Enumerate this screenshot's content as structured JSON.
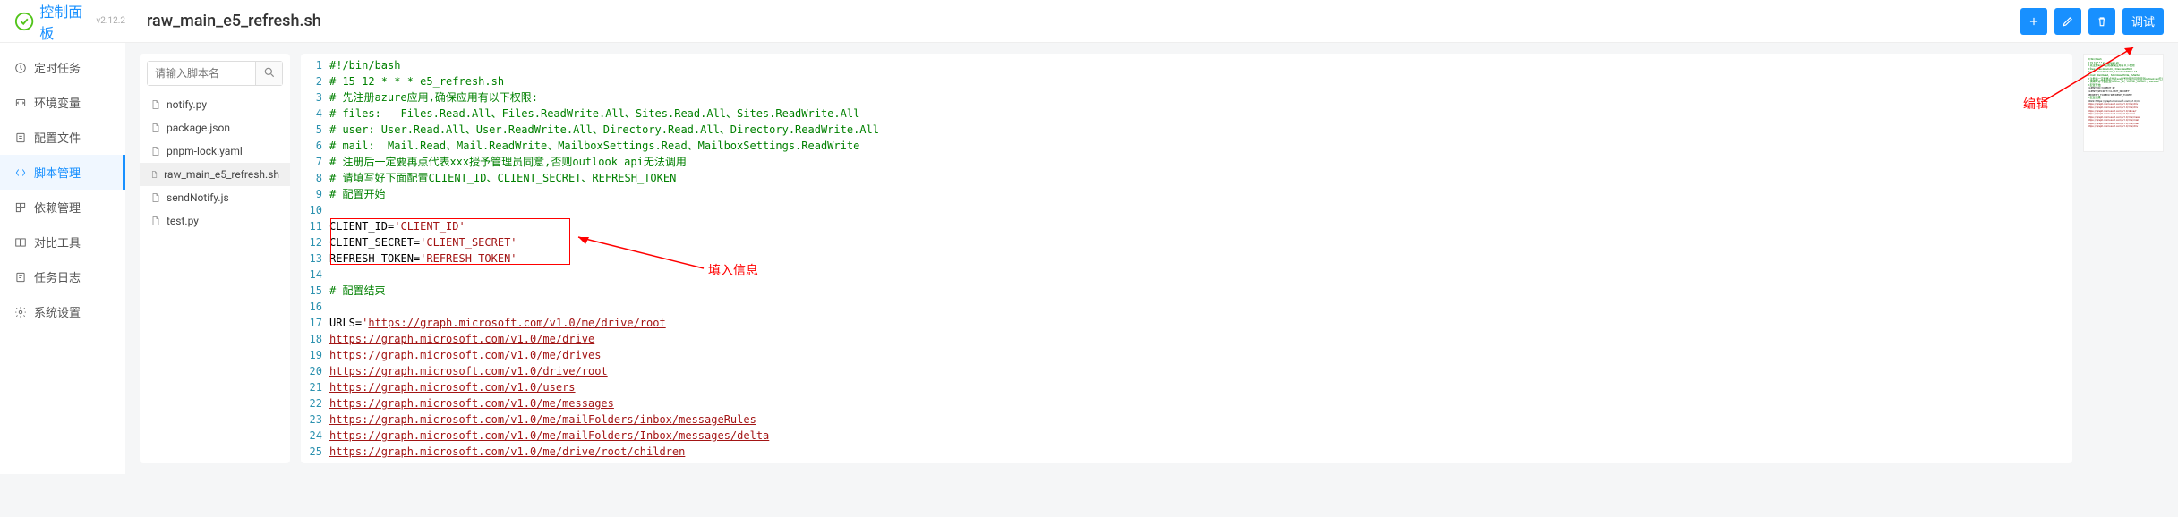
{
  "header": {
    "logo_title": "控制面板",
    "version": "v2.12.2",
    "page_title": "raw_main_e5_refresh.sh",
    "debug_btn": "调试"
  },
  "sidebar": {
    "items": [
      {
        "icon": "clock",
        "label": "定时任务"
      },
      {
        "icon": "env",
        "label": "环境变量"
      },
      {
        "icon": "config",
        "label": "配置文件"
      },
      {
        "icon": "script",
        "label": "脚本管理"
      },
      {
        "icon": "deps",
        "label": "依赖管理"
      },
      {
        "icon": "diff",
        "label": "对比工具"
      },
      {
        "icon": "log",
        "label": "任务日志"
      },
      {
        "icon": "settings",
        "label": "系统设置"
      }
    ],
    "active_index": 3
  },
  "file_panel": {
    "search_placeholder": "请输入脚本名",
    "files": [
      {
        "name": "notify.py"
      },
      {
        "name": "package.json"
      },
      {
        "name": "pnpm-lock.yaml"
      },
      {
        "name": "raw_main_e5_refresh.sh"
      },
      {
        "name": "sendNotify.js"
      },
      {
        "name": "test.py"
      }
    ],
    "active_index": 3
  },
  "editor": {
    "lines": [
      {
        "n": 1,
        "cls": "c-comment",
        "t": "#!/bin/bash"
      },
      {
        "n": 2,
        "cls": "c-comment",
        "t": "# 15 12 * * * e5_refresh.sh"
      },
      {
        "n": 3,
        "cls": "c-comment",
        "t": "# 先注册azure应用,确保应用有以下权限:"
      },
      {
        "n": 4,
        "cls": "c-comment",
        "t": "# files:   Files.Read.All、Files.ReadWrite.All、Sites.Read.All、Sites.ReadWrite.All"
      },
      {
        "n": 5,
        "cls": "c-comment",
        "t": "# user: User.Read.All、User.ReadWrite.All、Directory.Read.All、Directory.ReadWrite.All"
      },
      {
        "n": 6,
        "cls": "c-comment",
        "t": "# mail:  Mail.Read、Mail.ReadWrite、MailboxSettings.Read、MailboxSettings.ReadWrite"
      },
      {
        "n": 7,
        "cls": "c-comment",
        "t": "# 注册后一定要再点代表xxx授予管理员同意,否则outlook api无法调用"
      },
      {
        "n": 8,
        "cls": "c-comment",
        "t": "# 请填写好下面配置CLIENT_ID、CLIENT_SECRET、REFRESH_TOKEN"
      },
      {
        "n": 9,
        "cls": "c-comment",
        "t": "# 配置开始"
      },
      {
        "n": 10,
        "cls": "",
        "t": ""
      },
      {
        "n": 11,
        "cls": "",
        "html": "<span class='c-var'>CLIENT_ID=</span><span class='c-string'>'CLIENT_ID'</span>"
      },
      {
        "n": 12,
        "cls": "",
        "html": "<span class='c-var'>CLIENT_SECRET=</span><span class='c-string'>'CLIENT_SECRET'</span>"
      },
      {
        "n": 13,
        "cls": "",
        "html": "<span class='c-var'>REFRESH_TOKEN=</span><span class='c-string'>'REFRESH_TOKEN'</span>"
      },
      {
        "n": 14,
        "cls": "",
        "t": ""
      },
      {
        "n": 15,
        "cls": "c-comment",
        "t": "# 配置结束"
      },
      {
        "n": 16,
        "cls": "",
        "t": ""
      },
      {
        "n": 17,
        "cls": "",
        "html": "<span class='c-var'>URLS=</span><span class='c-string'>'</span><span class='c-url'>https://graph.microsoft.com/v1.0/me/drive/root</span>"
      },
      {
        "n": 18,
        "cls": "c-url",
        "t": "https://graph.microsoft.com/v1.0/me/drive"
      },
      {
        "n": 19,
        "cls": "c-url",
        "t": "https://graph.microsoft.com/v1.0/me/drives"
      },
      {
        "n": 20,
        "cls": "c-url",
        "t": "https://graph.microsoft.com/v1.0/drive/root"
      },
      {
        "n": 21,
        "cls": "c-url",
        "t": "https://graph.microsoft.com/v1.0/users"
      },
      {
        "n": 22,
        "cls": "c-url",
        "t": "https://graph.microsoft.com/v1.0/me/messages"
      },
      {
        "n": 23,
        "cls": "c-url",
        "t": "https://graph.microsoft.com/v1.0/me/mailFolders/inbox/messageRules"
      },
      {
        "n": 24,
        "cls": "c-url",
        "t": "https://graph.microsoft.com/v1.0/me/mailFolders/Inbox/messages/delta"
      },
      {
        "n": 25,
        "cls": "c-url",
        "t": "https://graph.microsoft.com/v1.0/me/drive/root/children"
      }
    ]
  },
  "annotations": {
    "fill_info": "填入信息",
    "edit": "编辑"
  }
}
